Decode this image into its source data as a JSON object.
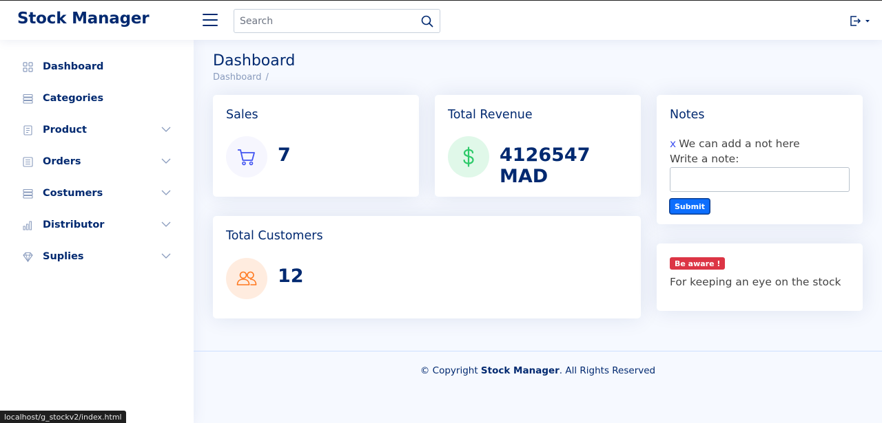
{
  "header": {
    "logo": "Stock Manager",
    "search_placeholder": "Search",
    "toggle_icon": "menu-icon",
    "search_icon": "search-icon",
    "profile_icon": "logout-icon"
  },
  "sidebar": {
    "items": [
      {
        "label": "Dashboard",
        "icon": "grid-icon",
        "has_children": false
      },
      {
        "label": "Categories",
        "icon": "stack-icon",
        "has_children": false
      },
      {
        "label": "Product",
        "icon": "document-icon",
        "has_children": true
      },
      {
        "label": "Orders",
        "icon": "list-icon",
        "has_children": true
      },
      {
        "label": "Costumers",
        "icon": "stack-icon",
        "has_children": true
      },
      {
        "label": "Distributor",
        "icon": "bar-chart-icon",
        "has_children": true
      },
      {
        "label": "Suplies",
        "icon": "gem-icon",
        "has_children": true
      }
    ]
  },
  "main": {
    "title": "Dashboard",
    "breadcrumb": [
      "Dashboard",
      "/"
    ],
    "cards": {
      "sales": {
        "title": "Sales",
        "value": "7",
        "icon": "cart-icon"
      },
      "revenue": {
        "title": "Total Revenue",
        "value": "4126547 MAD",
        "icon": "dollar-icon"
      },
      "customers": {
        "title": "Total Customers",
        "value": "12",
        "icon": "people-icon"
      }
    },
    "notes": {
      "title": "Notes",
      "delete_mark": "x",
      "note_item": "We can add a not here",
      "input_label": "Write a note:",
      "submit_label": "Submit"
    },
    "alert": {
      "badge": "Be aware !",
      "text": "For keeping an eye on the stock"
    }
  },
  "footer": {
    "prefix": "© Copyright",
    "brand": "Stock Manager",
    "suffix": ". All Rights Reserved"
  },
  "status_bar": "localhost/g_stockv2/index.html",
  "colors": {
    "primary": "#012970",
    "accent": "#4154f1",
    "revenue_green": "#2eca6a",
    "customers_orange": "#ff771d",
    "danger": "#dc3545",
    "button_blue": "#0d6efd"
  }
}
